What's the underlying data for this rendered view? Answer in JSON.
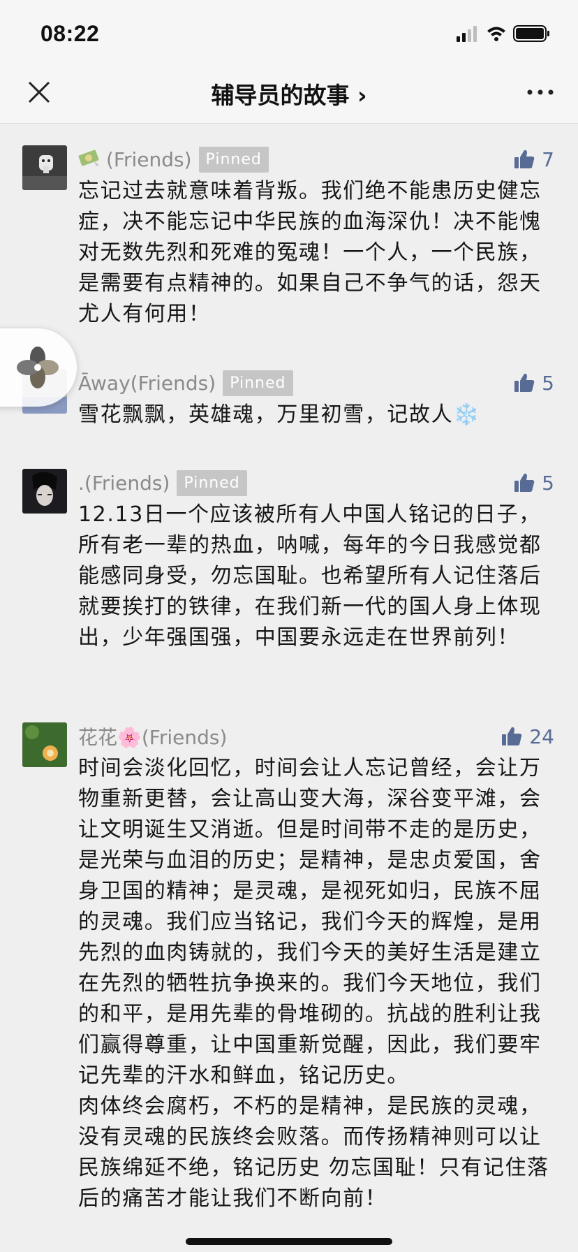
{
  "status": {
    "time": "08:22"
  },
  "nav": {
    "title": "辅导员的故事 ›"
  },
  "comments": [
    {
      "name": "(Friends)",
      "pinned": "Pinned",
      "likes": "7",
      "text": "忘记过去就意味着背叛。我们绝不能患历史健忘症，决不能忘记中华民族的血海深仇！决不能愧对无数先烈和死难的冤魂！一个人，一个民族，是需要有点精神的。如果自己不争气的话，怨天尤人有何用！"
    },
    {
      "name": "Āway(Friends)",
      "pinned": "Pinned",
      "likes": "5",
      "text": "雪花飘飘，英雄魂，万里初雪，记故人❄️"
    },
    {
      "name": ".(Friends)",
      "pinned": "Pinned",
      "likes": "5",
      "text": "12.13日一个应该被所有人中国人铭记的日子，所有老一辈的热血，呐喊，每年的今日我感觉都能感同身受，勿忘国耻。也希望所有人记住落后就要挨打的铁律，在我们新一代的国人身上体现出，少年强国强，中国要永远走在世界前列！"
    },
    {
      "name": "花花🌸(Friends)",
      "likes": "24",
      "text": "时间会淡化回忆，时间会让人忘记曾经，会让万物重新更替，会让高山变大海，深谷变平滩，会让文明诞生又消逝。但是时间带不走的是历史，是光荣与血泪的历史；是精神，是忠贞爱国，舍身卫国的精神；是灵魂，是视死如归，民族不屈的灵魂。我们应当铭记，我们今天的辉煌，是用先烈的血肉铸就的，我们今天的美好生活是建立在先烈的牺牲抗争换来的。我们今天地位，我们的和平，是用先辈的骨堆砌的。抗战的胜利让我们赢得尊重，让中国重新觉醒，因此，我们要牢记先辈的汗水和鲜血，铭记历史。",
      "text2": "肉体终会腐朽，不朽的是精神，是民族的灵魂，没有灵魂的民族终会败落。而传扬精神则可以让民族绵延不绝，铭记历史 勿忘国耻！只有记住落后的痛苦才能让我们不断向前！"
    }
  ],
  "colors": {
    "link": "#576b95",
    "pinned_bg": "#c6c6c6",
    "background": "#efefef"
  }
}
